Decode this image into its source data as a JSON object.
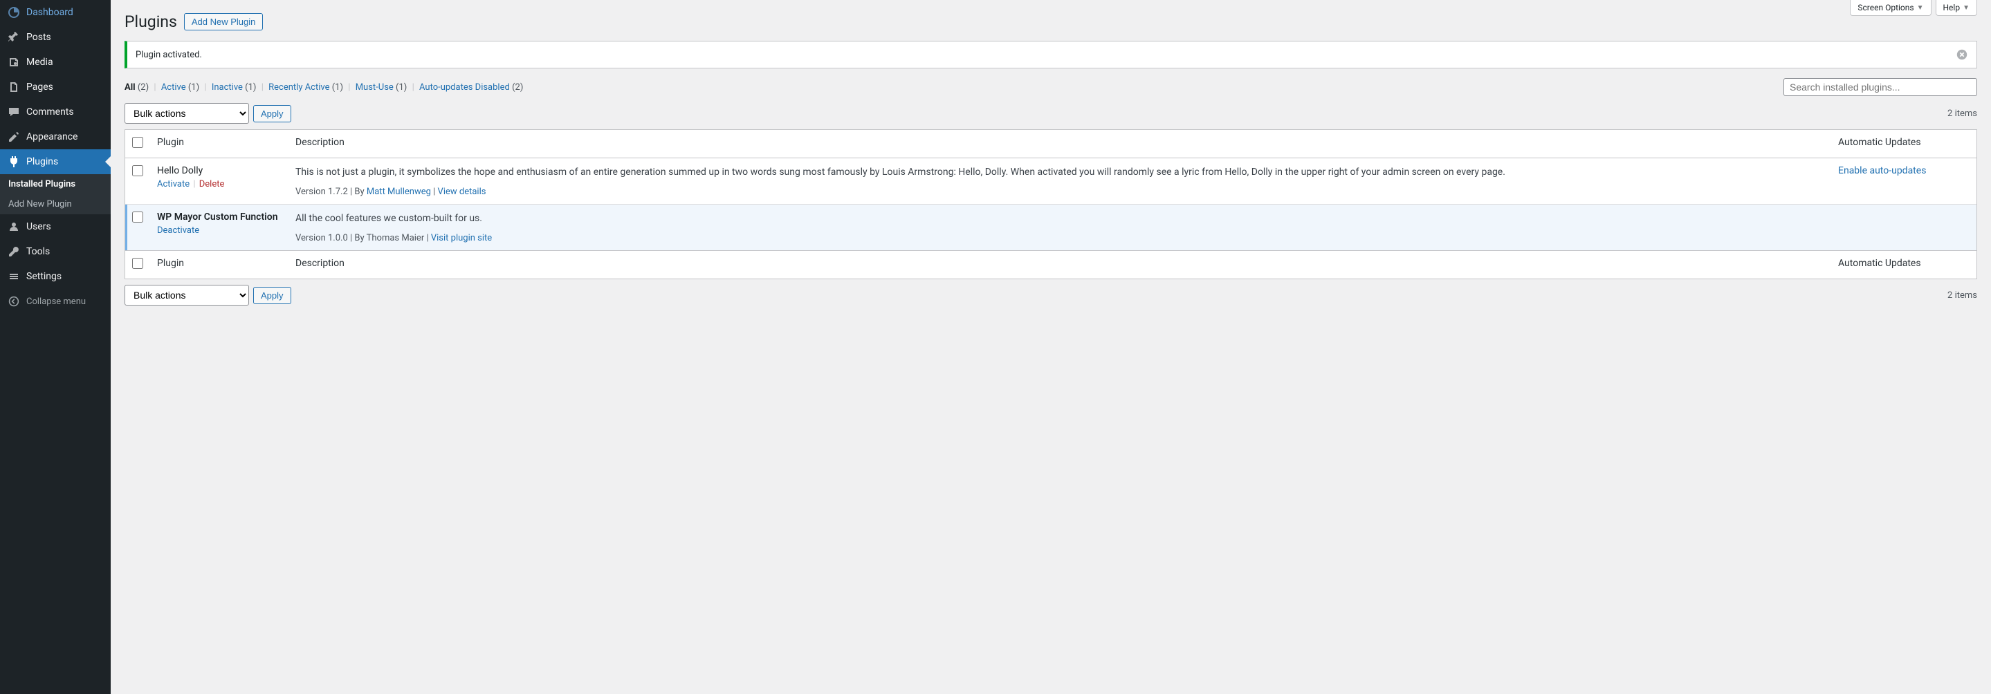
{
  "topTabs": {
    "screenOptions": "Screen Options",
    "help": "Help"
  },
  "sidebar": {
    "items": [
      {
        "label": "Dashboard"
      },
      {
        "label": "Posts"
      },
      {
        "label": "Media"
      },
      {
        "label": "Pages"
      },
      {
        "label": "Comments"
      },
      {
        "label": "Appearance"
      },
      {
        "label": "Plugins"
      },
      {
        "label": "Users"
      },
      {
        "label": "Tools"
      },
      {
        "label": "Settings"
      }
    ],
    "submenu": [
      {
        "label": "Installed Plugins"
      },
      {
        "label": "Add New Plugin"
      }
    ],
    "collapse": "Collapse menu"
  },
  "header": {
    "title": "Plugins",
    "addNew": "Add New Plugin"
  },
  "notice": "Plugin activated.",
  "filters": {
    "allLabel": "All",
    "allCount": "(2)",
    "activeLabel": "Active",
    "activeCount": "(1)",
    "inactiveLabel": "Inactive",
    "inactiveCount": "(1)",
    "recentLabel": "Recently Active",
    "recentCount": "(1)",
    "mustUseLabel": "Must-Use",
    "mustUseCount": "(1)",
    "autoDisLabel": "Auto-updates Disabled",
    "autoDisCount": "(2)"
  },
  "search": {
    "placeholder": "Search installed plugins..."
  },
  "bulk": {
    "label": "Bulk actions",
    "apply": "Apply"
  },
  "itemCount": "2 items",
  "table": {
    "colPlugin": "Plugin",
    "colDescription": "Description",
    "colAuto": "Automatic Updates"
  },
  "plugins": [
    {
      "name": "Hello Dolly",
      "active": false,
      "actions": {
        "a1": "Activate",
        "a2": "Delete"
      },
      "desc": "This is not just a plugin, it symbolizes the hope and enthusiasm of an entire generation summed up in two words sung most famously by Louis Armstrong: Hello, Dolly. When activated you will randomly see a lyric from Hello, Dolly in the upper right of your admin screen on every page.",
      "metaVersion": "Version 1.7.2",
      "metaBy": "By",
      "metaAuthor": "Matt Mullenweg",
      "metaDetails": "View details",
      "autoLink": "Enable auto-updates"
    },
    {
      "name": "WP Mayor Custom Function",
      "active": true,
      "actions": {
        "a1": "Deactivate"
      },
      "desc": "All the cool features we custom-built for us.",
      "metaVersion": "Version 1.0.0",
      "metaByAuthor": "By Thomas Maier",
      "metaDetails": "Visit plugin site"
    }
  ]
}
